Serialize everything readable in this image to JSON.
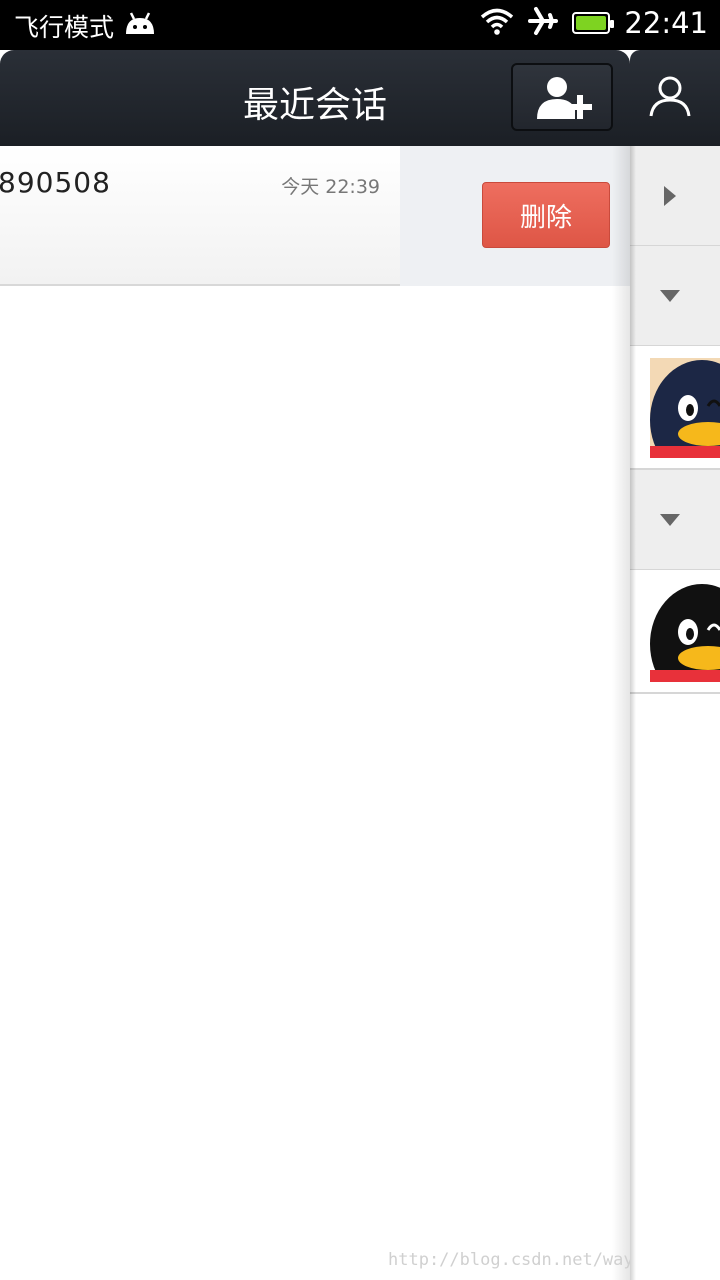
{
  "status_bar": {
    "mode_label": "飞行模式",
    "time": "22:41",
    "icons": [
      "android-icon",
      "wifi-icon",
      "airplane-icon",
      "battery-icon"
    ],
    "battery_color": "#7ed321"
  },
  "header": {
    "title": "最近会话",
    "add_contact_icon": "add-contact-icon"
  },
  "conversations": [
    {
      "name": "890508",
      "time": "今天 22:39",
      "delete_label": "删除"
    }
  ],
  "drawer": {
    "header_icon": "person-icon",
    "rows": [
      {
        "type": "group",
        "state": "collapsed"
      },
      {
        "type": "group",
        "state": "expanded"
      },
      {
        "type": "friend",
        "avatar": "qq-penguin-avatar"
      },
      {
        "type": "group",
        "state": "expanded"
      },
      {
        "type": "friend",
        "avatar": "qq-penguin-avatar"
      }
    ]
  },
  "watermark": "http://blog.csdn.net/way_ping_li",
  "colors": {
    "header": "#1f242b",
    "delete_button": "#e8604f"
  }
}
